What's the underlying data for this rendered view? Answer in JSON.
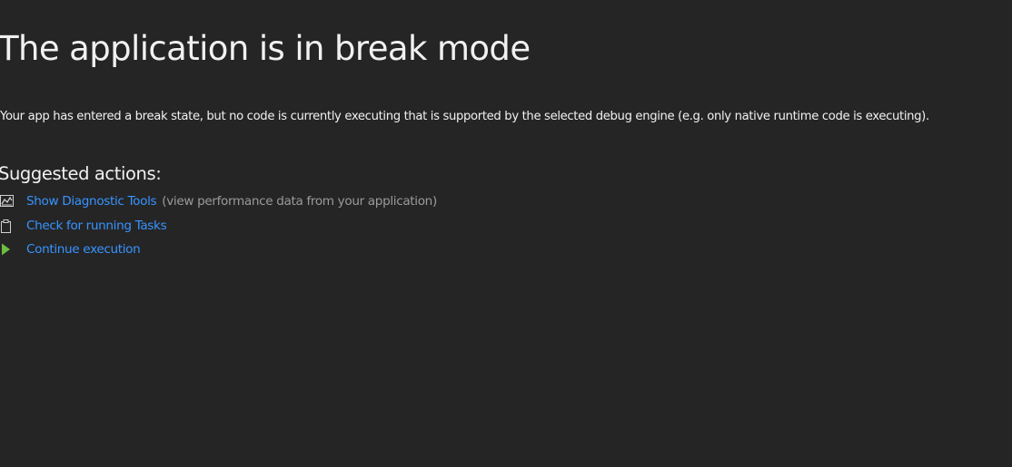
{
  "title": "The application is in break mode",
  "description": "Your app has entered a break state, but no code is currently executing that is supported by the selected debug engine (e.g. only native runtime code is executing).",
  "suggested_heading": "Suggested actions:",
  "actions": [
    {
      "icon": "diagnostic-chart-icon",
      "label": "Show Diagnostic Tools",
      "hint": "(view performance data from your application)"
    },
    {
      "icon": "clipboard-icon",
      "label": "Check for running Tasks",
      "hint": ""
    },
    {
      "icon": "play-icon",
      "label": "Continue execution",
      "hint": ""
    }
  ],
  "colors": {
    "background": "#252526",
    "text": "#f1f1f1",
    "link": "#3794ff",
    "hint": "#9b9b9b",
    "play": "#6cbf3c"
  }
}
